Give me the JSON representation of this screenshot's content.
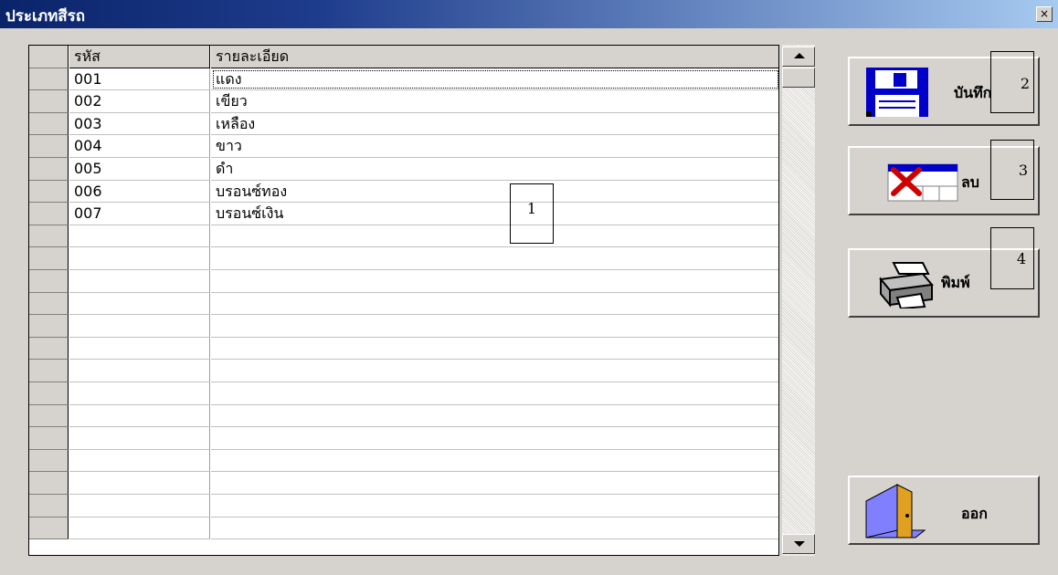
{
  "window": {
    "title": "ประเภทสีรถ",
    "close_label": "×"
  },
  "grid": {
    "columns": [
      "รหัส",
      "รายละเอียด"
    ],
    "rows": [
      {
        "code": "001",
        "desc": "แดง"
      },
      {
        "code": "002",
        "desc": "เขียว"
      },
      {
        "code": "003",
        "desc": "เหลือง"
      },
      {
        "code": "004",
        "desc": "ขาว"
      },
      {
        "code": "005",
        "desc": "ดำ"
      },
      {
        "code": "006",
        "desc": "บรอนซ์ทอง"
      },
      {
        "code": "007",
        "desc": "บรอนซ์เงิน"
      }
    ],
    "empty_rows": 14
  },
  "buttons": {
    "save": "บันทึก",
    "delete": "ลบ",
    "print": "พิมพ์",
    "exit": "ออก"
  },
  "annotations": [
    "1",
    "2",
    "3",
    "4"
  ],
  "colors": {
    "face": "#d6d3ce",
    "title_start": "#0a246a",
    "title_end": "#a6caf0"
  }
}
